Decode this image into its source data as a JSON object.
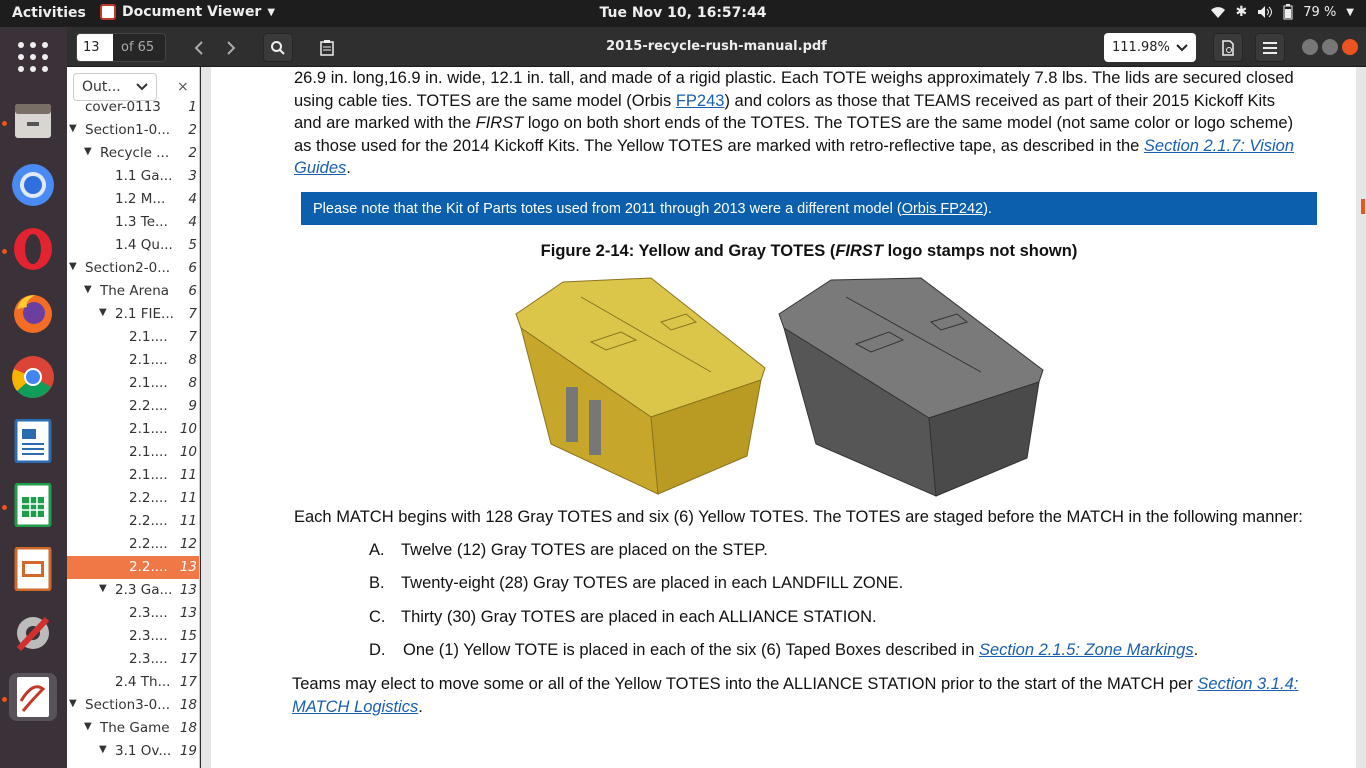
{
  "topbar": {
    "activities": "Activities",
    "app_name": "Document Viewer",
    "clock": "Tue Nov 10, 16:57:44",
    "battery": "79 %"
  },
  "header": {
    "page_number": "13",
    "page_of": "of 65",
    "title": "2015-recycle-rush-manual.pdf",
    "zoom": "111.98%"
  },
  "sidebar": {
    "mode_label": "Out...",
    "close": "×",
    "items": [
      {
        "label": "cover-0113",
        "page": "1",
        "depth": 0,
        "arrow": ""
      },
      {
        "label": "Section1-0...",
        "page": "2",
        "depth": 0,
        "arrow": "down"
      },
      {
        "label": "Recycle ...",
        "page": "2",
        "depth": 1,
        "arrow": "down"
      },
      {
        "label": "1.1 Ga...",
        "page": "3",
        "depth": 2,
        "arrow": ""
      },
      {
        "label": "1.2 M...",
        "page": "4",
        "depth": 2,
        "arrow": ""
      },
      {
        "label": "1.3 Te...",
        "page": "4",
        "depth": 2,
        "arrow": ""
      },
      {
        "label": "1.4 Qu...",
        "page": "5",
        "depth": 2,
        "arrow": ""
      },
      {
        "label": "Section2-0...",
        "page": "6",
        "depth": 0,
        "arrow": "down"
      },
      {
        "label": "The Arena",
        "page": "6",
        "depth": 1,
        "arrow": "down"
      },
      {
        "label": "2.1 FIE...",
        "page": "7",
        "depth": 2,
        "arrow": "down"
      },
      {
        "label": "2.1....",
        "page": "7",
        "depth": 3,
        "arrow": ""
      },
      {
        "label": "2.1....",
        "page": "8",
        "depth": 3,
        "arrow": ""
      },
      {
        "label": "2.1....",
        "page": "8",
        "depth": 3,
        "arrow": ""
      },
      {
        "label": "2.2....",
        "page": "9",
        "depth": 3,
        "arrow": ""
      },
      {
        "label": "2.1....",
        "page": "10",
        "depth": 3,
        "arrow": ""
      },
      {
        "label": "2.1....",
        "page": "10",
        "depth": 3,
        "arrow": ""
      },
      {
        "label": "2.1....",
        "page": "11",
        "depth": 3,
        "arrow": ""
      },
      {
        "label": "2.2....",
        "page": "11",
        "depth": 3,
        "arrow": ""
      },
      {
        "label": "2.2....",
        "page": "11",
        "depth": 3,
        "arrow": ""
      },
      {
        "label": "2.2....",
        "page": "12",
        "depth": 3,
        "arrow": ""
      },
      {
        "label": "2.2....",
        "page": "13",
        "depth": 3,
        "arrow": "",
        "selected": true
      },
      {
        "label": "2.3 Ga...",
        "page": "13",
        "depth": 2,
        "arrow": "down"
      },
      {
        "label": "2.3....",
        "page": "13",
        "depth": 3,
        "arrow": ""
      },
      {
        "label": "2.3....",
        "page": "15",
        "depth": 3,
        "arrow": ""
      },
      {
        "label": "2.3....",
        "page": "17",
        "depth": 3,
        "arrow": ""
      },
      {
        "label": "2.4 Th...",
        "page": "17",
        "depth": 2,
        "arrow": ""
      },
      {
        "label": "Section3-0...",
        "page": "18",
        "depth": 0,
        "arrow": "down"
      },
      {
        "label": "The Game",
        "page": "18",
        "depth": 1,
        "arrow": "down"
      },
      {
        "label": "3.1 Ov...",
        "page": "19",
        "depth": 2,
        "arrow": "down"
      }
    ]
  },
  "doc": {
    "para1_l1": "26.9 in. long,16.9 in. wide, 12.1 in. tall, and made of a rigid plastic. Each TOTE weighs approximately 7.8 lbs. The lids are secured closed",
    "para1_l2a": "using cable ties. TOTES are the same model (Orbis ",
    "para1_l2link": "FP243",
    "para1_l2b": ") and colors as those that TEAMS received as part of their 2015 Kickoff Kits",
    "para1_l3a": "and are marked with the ",
    "para1_l3first": "FIRST",
    "para1_l3b": " logo on both short ends of the TOTES. The TOTES are the same model (not same color or logo scheme)",
    "para1_l4a": "as those used for the 2014 Kickoff Kits. The Yellow TOTES are marked with retro-reflective tape, as described in the ",
    "para1_l4link": "Section 2.1.7: Vision",
    "para1_l5link": "Guides",
    "para1_l5b": ".",
    "note_a": "Please note that the Kit of Parts totes used from 2011 through 2013 were a different model (",
    "note_link": "Orbis FP242",
    "note_b": ").",
    "fig_a": "Figure 2-14: Yellow and Gray TOTES (",
    "fig_first": "FIRST",
    "fig_b": " logo stamps not shown)",
    "para2": "Each MATCH begins with 128 Gray TOTES and six (6) Yellow TOTES. The TOTES are staged before the MATCH in the following manner:",
    "list": [
      {
        "letter": "A.",
        "text": "Twelve (12) Gray TOTES are placed on the STEP."
      },
      {
        "letter": "B.",
        "text": "Twenty-eight (28) Gray TOTES are placed in each LANDFILL ZONE."
      },
      {
        "letter": "C.",
        "text": "Thirty (30) Gray TOTES are placed in each ALLIANCE STATION."
      },
      {
        "letter": "D.",
        "text": "One (1) Yellow TOTE is placed in each of the six (6) Taped Boxes described in "
      }
    ],
    "list_d_link": "Section 2.1.5: Zone Markings",
    "list_d_end": ".",
    "para3_a": "Teams may elect to move some or all of the Yellow TOTES into the ALLIANCE STATION prior to the start of the MATCH per ",
    "para3_link1": "Section 3.1.4:",
    "para3_link2": "MATCH Logistics",
    "para3_end": "."
  },
  "colors": {
    "accent": "#e95420",
    "note_bg": "#0b5fad",
    "selected_row": "#f07746",
    "tote_yellow": "#d4b32c",
    "tote_gray": "#5a5a5a"
  },
  "icons": [
    "back-arrow-icon",
    "forward-arrow-icon",
    "search-icon",
    "annotations-icon",
    "hamburger-menu-icon",
    "wifi-icon",
    "bluetooth-icon",
    "volume-icon",
    "battery-icon"
  ]
}
